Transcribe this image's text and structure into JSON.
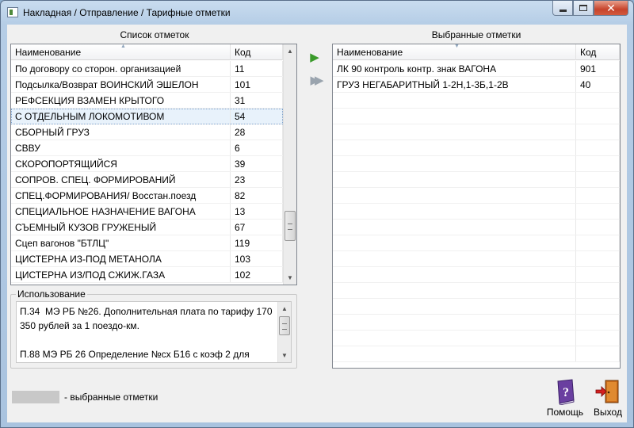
{
  "window": {
    "title": "Накладная / Отправление / Тарифные отметки"
  },
  "left_panel": {
    "title": "Список отметок",
    "columns": [
      "Наименование",
      "Код"
    ],
    "rows": [
      {
        "name": "По договору со сторон. организацией",
        "code": "11"
      },
      {
        "name": "Подсылка/Возврат ВОИНСКИЙ ЭШЕЛОН",
        "code": "101"
      },
      {
        "name": "РЕФСЕКЦИЯ ВЗАМЕН КРЫТОГО",
        "code": "31"
      },
      {
        "name": "С ОТДЕЛЬНЫМ ЛОКОМОТИВОМ",
        "code": "54"
      },
      {
        "name": "СБОРНЫЙ ГРУЗ",
        "code": "28"
      },
      {
        "name": "СВВУ",
        "code": "6"
      },
      {
        "name": "СКОРОПОРТЯЩИЙСЯ",
        "code": "39"
      },
      {
        "name": "СОПРОВ. СПЕЦ. ФОРМИРОВАНИЙ",
        "code": "23"
      },
      {
        "name": "СПЕЦ.ФОРМИРОВАНИЯ/ Восстан.поезд",
        "code": "82"
      },
      {
        "name": "СПЕЦИАЛЬНОЕ НАЗНАЧЕНИЕ ВАГОНА",
        "code": "13"
      },
      {
        "name": "СЪЕМНЫЙ КУЗОВ ГРУЖЕНЫЙ",
        "code": "67"
      },
      {
        "name": "Сцеп вагонов \"БТЛЦ\"",
        "code": "119"
      },
      {
        "name": "ЦИСТЕРНА ИЗ-ПОД МЕТАНОЛА",
        "code": "103"
      },
      {
        "name": "ЦИСТЕРНА ИЗ/ПОД СЖИЖ.ГАЗА",
        "code": "102"
      }
    ],
    "selected_index": 3
  },
  "right_panel": {
    "title": "Выбранные отметки",
    "columns": [
      "Наименование",
      "Код"
    ],
    "rows": [
      {
        "name": "ЛК 90 контроль  контр. знак ВАГОНА",
        "code": "901"
      },
      {
        "name": "ГРУЗ НЕГАБАРИТНЫЙ 1-2Н,1-3Б,1-2В",
        "code": "40"
      }
    ]
  },
  "usage": {
    "label": "Использование",
    "text": "П.34  МЭ РБ №26. Дополнительная плата по тарифу 170 350 рублей за 1 поездо-км.\n\nП.88 МЭ РБ 26 Определение №сх Б16 с коэф 2 для"
  },
  "legend": {
    "label": "-  выбранные отметки",
    "swatch_color": "#c8c8c8"
  },
  "buttons": {
    "help": "Помощь",
    "exit": "Выход"
  },
  "colors": {
    "move_one_arrow": "#3a9a2a",
    "move_all_arrow": "#9aa4ae",
    "selection_bg": "#e8f2fb"
  }
}
